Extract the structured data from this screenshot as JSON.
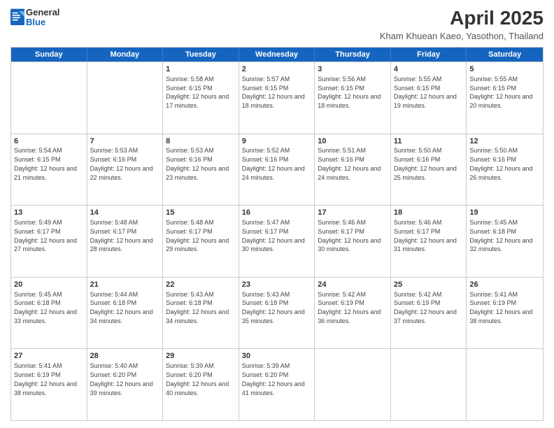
{
  "header": {
    "logo_general": "General",
    "logo_blue": "Blue",
    "main_title": "April 2025",
    "subtitle": "Kham Khuean Kaeo, Yasothon, Thailand"
  },
  "weekdays": [
    "Sunday",
    "Monday",
    "Tuesday",
    "Wednesday",
    "Thursday",
    "Friday",
    "Saturday"
  ],
  "rows": [
    [
      {
        "day": "",
        "detail": ""
      },
      {
        "day": "",
        "detail": ""
      },
      {
        "day": "1",
        "detail": "Sunrise: 5:58 AM\nSunset: 6:15 PM\nDaylight: 12 hours and 17 minutes."
      },
      {
        "day": "2",
        "detail": "Sunrise: 5:57 AM\nSunset: 6:15 PM\nDaylight: 12 hours and 18 minutes."
      },
      {
        "day": "3",
        "detail": "Sunrise: 5:56 AM\nSunset: 6:15 PM\nDaylight: 12 hours and 18 minutes."
      },
      {
        "day": "4",
        "detail": "Sunrise: 5:55 AM\nSunset: 6:15 PM\nDaylight: 12 hours and 19 minutes."
      },
      {
        "day": "5",
        "detail": "Sunrise: 5:55 AM\nSunset: 6:15 PM\nDaylight: 12 hours and 20 minutes."
      }
    ],
    [
      {
        "day": "6",
        "detail": "Sunrise: 5:54 AM\nSunset: 6:15 PM\nDaylight: 12 hours and 21 minutes."
      },
      {
        "day": "7",
        "detail": "Sunrise: 5:53 AM\nSunset: 6:16 PM\nDaylight: 12 hours and 22 minutes."
      },
      {
        "day": "8",
        "detail": "Sunrise: 5:53 AM\nSunset: 6:16 PM\nDaylight: 12 hours and 23 minutes."
      },
      {
        "day": "9",
        "detail": "Sunrise: 5:52 AM\nSunset: 6:16 PM\nDaylight: 12 hours and 24 minutes."
      },
      {
        "day": "10",
        "detail": "Sunrise: 5:51 AM\nSunset: 6:16 PM\nDaylight: 12 hours and 24 minutes."
      },
      {
        "day": "11",
        "detail": "Sunrise: 5:50 AM\nSunset: 6:16 PM\nDaylight: 12 hours and 25 minutes."
      },
      {
        "day": "12",
        "detail": "Sunrise: 5:50 AM\nSunset: 6:16 PM\nDaylight: 12 hours and 26 minutes."
      }
    ],
    [
      {
        "day": "13",
        "detail": "Sunrise: 5:49 AM\nSunset: 6:17 PM\nDaylight: 12 hours and 27 minutes."
      },
      {
        "day": "14",
        "detail": "Sunrise: 5:48 AM\nSunset: 6:17 PM\nDaylight: 12 hours and 28 minutes."
      },
      {
        "day": "15",
        "detail": "Sunrise: 5:48 AM\nSunset: 6:17 PM\nDaylight: 12 hours and 29 minutes."
      },
      {
        "day": "16",
        "detail": "Sunrise: 5:47 AM\nSunset: 6:17 PM\nDaylight: 12 hours and 30 minutes."
      },
      {
        "day": "17",
        "detail": "Sunrise: 5:46 AM\nSunset: 6:17 PM\nDaylight: 12 hours and 30 minutes."
      },
      {
        "day": "18",
        "detail": "Sunrise: 5:46 AM\nSunset: 6:17 PM\nDaylight: 12 hours and 31 minutes."
      },
      {
        "day": "19",
        "detail": "Sunrise: 5:45 AM\nSunset: 6:18 PM\nDaylight: 12 hours and 32 minutes."
      }
    ],
    [
      {
        "day": "20",
        "detail": "Sunrise: 5:45 AM\nSunset: 6:18 PM\nDaylight: 12 hours and 33 minutes."
      },
      {
        "day": "21",
        "detail": "Sunrise: 5:44 AM\nSunset: 6:18 PM\nDaylight: 12 hours and 34 minutes."
      },
      {
        "day": "22",
        "detail": "Sunrise: 5:43 AM\nSunset: 6:18 PM\nDaylight: 12 hours and 34 minutes."
      },
      {
        "day": "23",
        "detail": "Sunrise: 5:43 AM\nSunset: 6:18 PM\nDaylight: 12 hours and 35 minutes."
      },
      {
        "day": "24",
        "detail": "Sunrise: 5:42 AM\nSunset: 6:19 PM\nDaylight: 12 hours and 36 minutes."
      },
      {
        "day": "25",
        "detail": "Sunrise: 5:42 AM\nSunset: 6:19 PM\nDaylight: 12 hours and 37 minutes."
      },
      {
        "day": "26",
        "detail": "Sunrise: 5:41 AM\nSunset: 6:19 PM\nDaylight: 12 hours and 38 minutes."
      }
    ],
    [
      {
        "day": "27",
        "detail": "Sunrise: 5:41 AM\nSunset: 6:19 PM\nDaylight: 12 hours and 38 minutes."
      },
      {
        "day": "28",
        "detail": "Sunrise: 5:40 AM\nSunset: 6:20 PM\nDaylight: 12 hours and 39 minutes."
      },
      {
        "day": "29",
        "detail": "Sunrise: 5:39 AM\nSunset: 6:20 PM\nDaylight: 12 hours and 40 minutes."
      },
      {
        "day": "30",
        "detail": "Sunrise: 5:39 AM\nSunset: 6:20 PM\nDaylight: 12 hours and 41 minutes."
      },
      {
        "day": "",
        "detail": ""
      },
      {
        "day": "",
        "detail": ""
      },
      {
        "day": "",
        "detail": ""
      }
    ]
  ]
}
